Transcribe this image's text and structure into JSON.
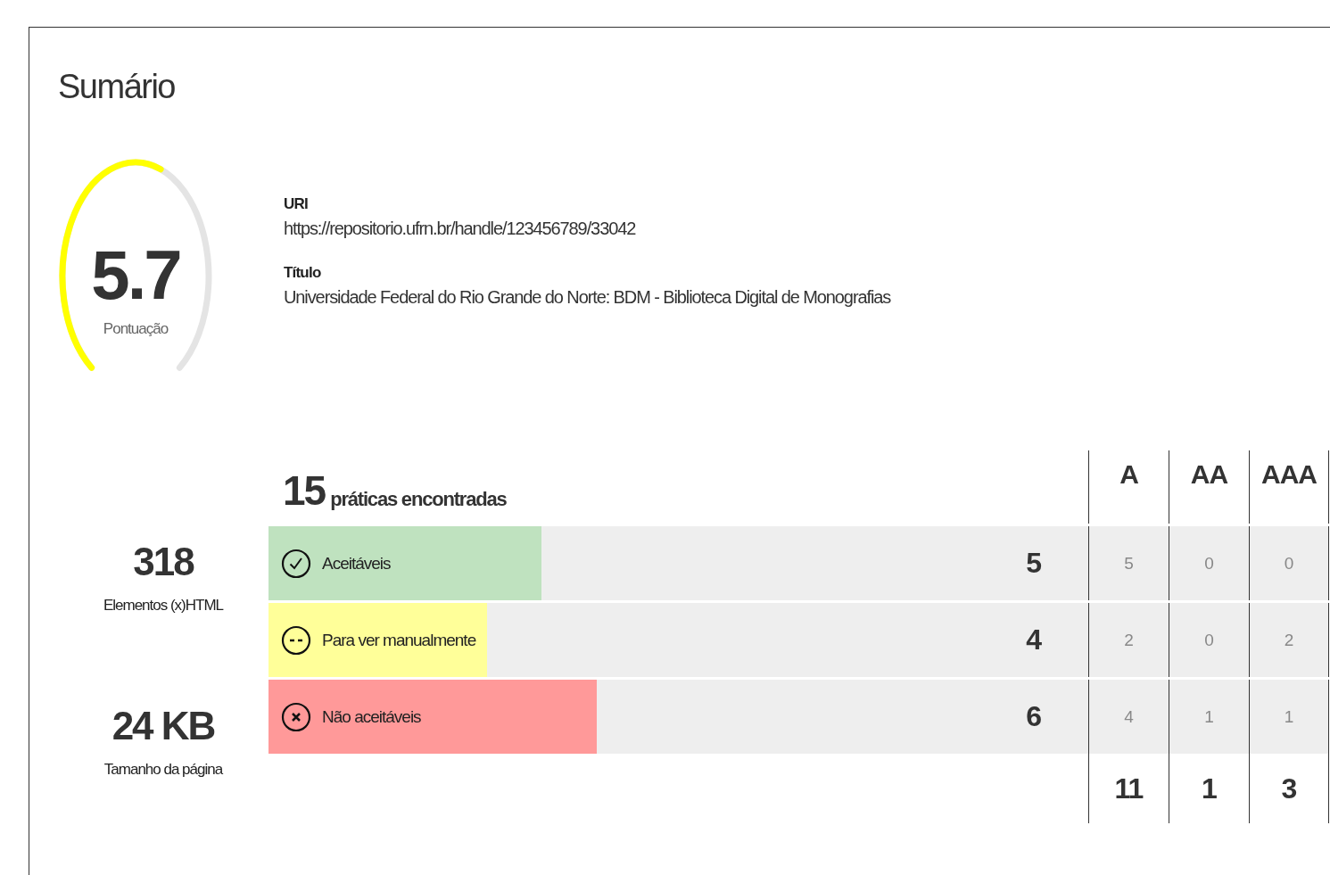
{
  "title": "Sumário",
  "score": {
    "value": "5.7",
    "label": "Pontuação"
  },
  "info": [
    {
      "label": "URI",
      "value": "https://repositorio.ufrn.br/handle/123456789/33042"
    },
    {
      "label": "Título",
      "value": "Universidade Federal do Rio Grande do Norte: BDM - Biblioteca Digital de Monografias"
    }
  ],
  "stats": [
    {
      "value": "318",
      "label": "Elementos (x)HTML"
    },
    {
      "value": "24 KB",
      "label": "Tamanho da página"
    }
  ],
  "practices": {
    "count": "15",
    "label": "práticas encontradas",
    "levels": [
      "A",
      "AA",
      "AAA"
    ],
    "rows": [
      {
        "kind": "pass",
        "label": "Aceitáveis",
        "count": "5",
        "level": 0.333,
        "color": "#bfe2bf",
        "by_level": [
          "5",
          "0",
          "0"
        ]
      },
      {
        "kind": "manual",
        "label": "Para ver manualmente",
        "count": "4",
        "level": 0.267,
        "color": "#ffff99",
        "by_level": [
          "2",
          "0",
          "2"
        ]
      },
      {
        "kind": "fail",
        "label": "Não aceitáveis",
        "count": "6",
        "level": 0.4,
        "color": "#ff9999",
        "by_level": [
          "4",
          "1",
          "1"
        ]
      }
    ],
    "totals": [
      "11",
      "1",
      "3"
    ]
  }
}
